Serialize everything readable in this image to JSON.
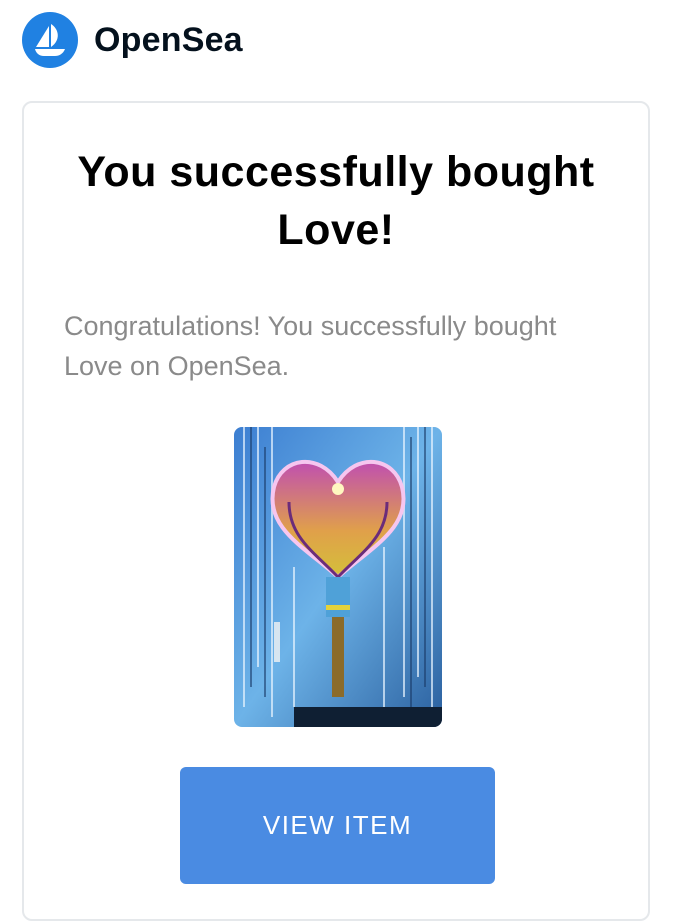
{
  "header": {
    "brand_name": "OpenSea",
    "logo_icon": "opensea-boat-icon",
    "brand_color": "#2081e2"
  },
  "card": {
    "title": "You successfully bought Love!",
    "message": "Congratulations! You successfully bought Love on OpenSea.",
    "nft_image_icon": "nft-artwork-image",
    "view_button_label": "VIEW ITEM",
    "button_color": "#4a8be2"
  }
}
